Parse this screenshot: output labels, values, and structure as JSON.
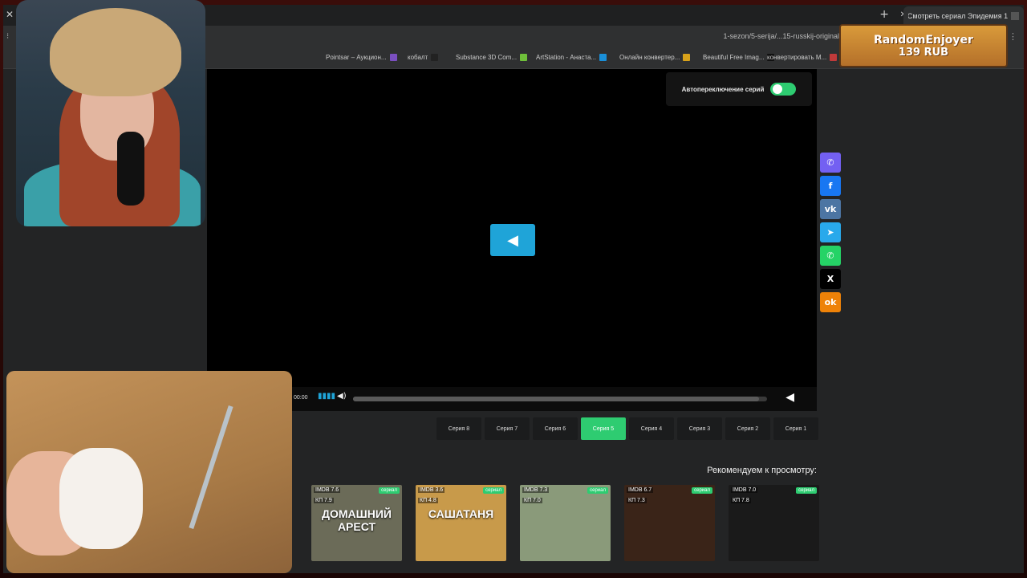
{
  "browser": {
    "tab_title": "Смотреть сериал Эпидемия 1",
    "url": "1-sezon/5-serija/...15-russkij-original",
    "bookmarks": [
      {
        "label": "Pointsar – Аукцион...",
        "color": "#7a4fbf"
      },
      {
        "label": "кобалт",
        "color": "#222"
      },
      {
        "label": "Substance 3D Com...",
        "color": "#6fbf3a"
      },
      {
        "label": "ArtStation - Анаста...",
        "color": "#1a8fd8"
      },
      {
        "label": "Онлайн конвертер...",
        "color": "#d8a21a"
      },
      {
        "label": "Beautiful Free Imag...",
        "color": "#111"
      },
      {
        "label": "конвертировать М...",
        "color": "#c03a3a"
      }
    ]
  },
  "player": {
    "autoplay_label": "Автопереключение серий",
    "time": "00:00"
  },
  "episodes": [
    {
      "label": "Серия 8",
      "active": false
    },
    {
      "label": "Серия 7",
      "active": false
    },
    {
      "label": "Серия 6",
      "active": false
    },
    {
      "label": "Серия 5",
      "active": true
    },
    {
      "label": "Серия 4",
      "active": false
    },
    {
      "label": "Серия 3",
      "active": false
    },
    {
      "label": "Серия 2",
      "active": false
    },
    {
      "label": "Серия 1",
      "active": false
    }
  ],
  "recommend_title": "Рекомендуем к просмотру:",
  "posters": [
    {
      "tag": "сериал",
      "imdb": "IMDB 7.6",
      "kp": "КП 7.9",
      "title": "ДОМАШНИЙ АРЕСТ",
      "bg": "#6b6b58"
    },
    {
      "tag": "сериал",
      "imdb": "IMDB 3.6",
      "kp": "КП 4.8",
      "title": "САШАТАНЯ",
      "bg": "#c89a4a"
    },
    {
      "tag": "сериал",
      "imdb": "IMDB 7.3",
      "kp": "КП 7.0",
      "title": "",
      "bg": "#8a9a7a"
    },
    {
      "tag": "сериал",
      "imdb": "IMDB 6.7",
      "kp": "КП 7.3",
      "title": "",
      "bg": "#3a2418"
    },
    {
      "tag": "сериал",
      "imdb": "IMDB 7.0",
      "kp": "КП 7.8",
      "title": "",
      "bg": "#1a1a1a"
    }
  ],
  "share": [
    {
      "icon": "viber-icon",
      "glyph": "✆",
      "color": "#7360f2"
    },
    {
      "icon": "facebook-icon",
      "glyph": "f",
      "color": "#1877f2"
    },
    {
      "icon": "vk-icon",
      "glyph": "vk",
      "color": "#4c75a3"
    },
    {
      "icon": "telegram-icon",
      "glyph": "➤",
      "color": "#29a9eb"
    },
    {
      "icon": "whatsapp-icon",
      "glyph": "✆",
      "color": "#25d366"
    },
    {
      "icon": "x-icon",
      "glyph": "X",
      "color": "#000000"
    },
    {
      "icon": "odnoklassniki-icon",
      "glyph": "ok",
      "color": "#ee8208"
    }
  ],
  "donation": {
    "name": "RandomEnjoyer",
    "amount": "139 RUB"
  },
  "colors": {
    "accent_green": "#2ecc71",
    "play_blue": "#1fa4d8"
  }
}
